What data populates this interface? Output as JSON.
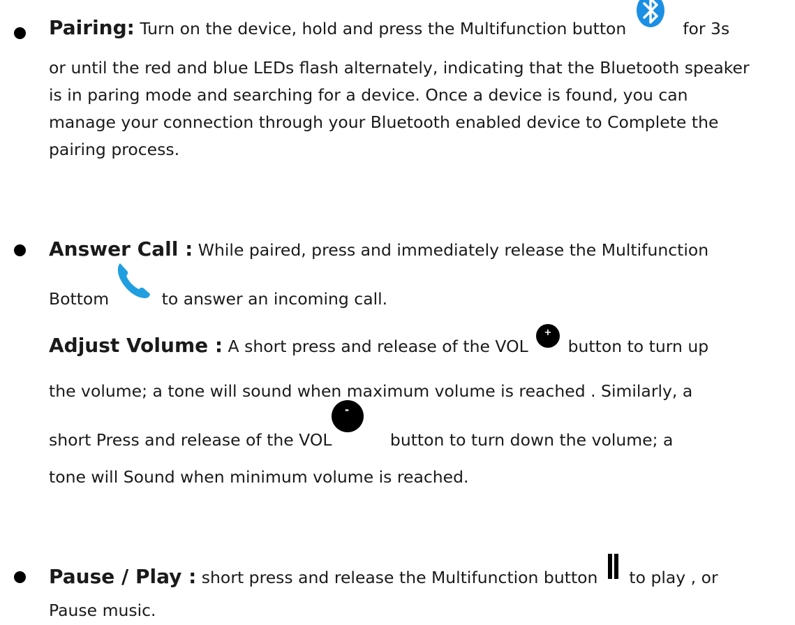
{
  "pairing": {
    "title": "Pairing:",
    "text1": " Turn on the device, hold and press the Multifunction button ",
    "text2": " for 3s",
    "body": "or until the red and blue LEDs flash alternately, indicating that the Bluetooth speaker is in paring mode and searching for a device. Once a device is found, you can manage your connection through your Bluetooth enabled device to Complete the pairing process.",
    "icon": "bluetooth-icon",
    "icon_color": "#1a8fe3"
  },
  "answer_call": {
    "title": "Answer Call :",
    "text1": " While paired, press and immediately release the Multifunction",
    "text2": "Bottom",
    "text3": " to answer an incoming call.",
    "icon": "phone-icon",
    "icon_color": "#1f9fe0"
  },
  "adjust_volume": {
    "title": "Adjust Volume :",
    "text1": " A short press and release of the VOL ",
    "text2": " button to turn up",
    "text3": "the volume; a tone will sound when maximum volume is reached . Similarly, a",
    "text4": "short Press and release of the VOL",
    "text5": " button to turn down the volume; a",
    "text6": "tone will Sound when minimum volume is reached.",
    "plus_icon": "volume-up-icon",
    "minus_icon": "volume-down-icon",
    "plus_symbol": "+",
    "minus_symbol": "-"
  },
  "pause_play": {
    "title": "Pause / Play :",
    "text1": " short press and release the Multifunction button ",
    "text2": " to play , or",
    "text3": "Pause music.",
    "icon": "pause-icon"
  }
}
